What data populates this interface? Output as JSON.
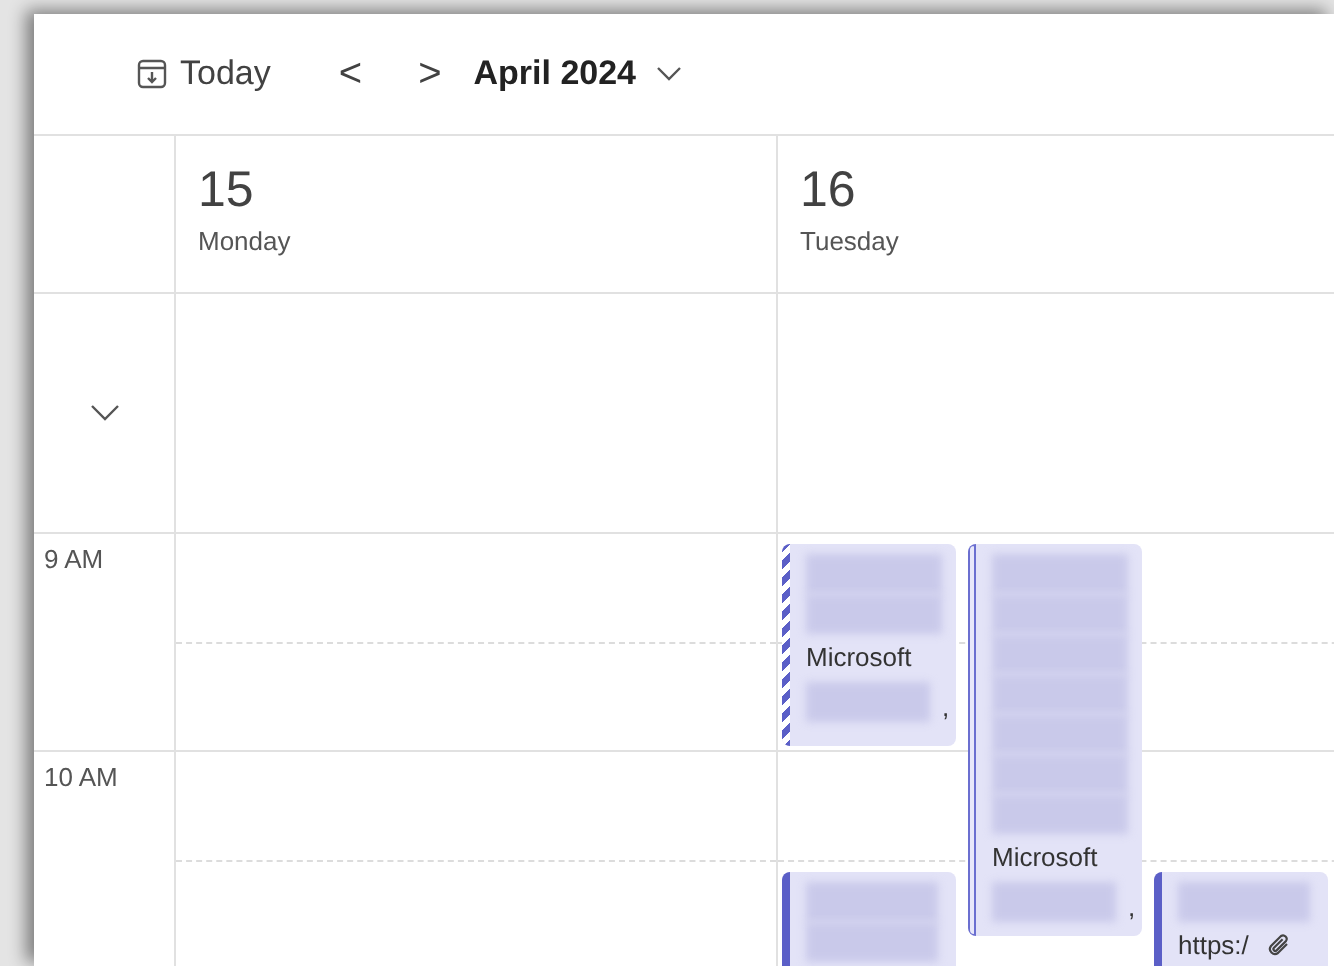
{
  "toolbar": {
    "today": "Today",
    "prev": "<",
    "next": ">",
    "month": "April 2024"
  },
  "days": [
    {
      "date": "15",
      "weekday": "Monday"
    },
    {
      "date": "16",
      "weekday": "Tuesday",
      "lanes": [
        [
          {
            "kind": "striped",
            "lines": [
              {
                "kind": "blurred"
              },
              {
                "kind": "blurred"
              },
              {
                "kind": "text",
                "text": "Microsoft"
              },
              {
                "kind": "blurred",
                "tail": ","
              }
            ]
          },
          {
            "kind": "gap"
          },
          {
            "kind": "solid",
            "lines": [
              {
                "kind": "blurred"
              },
              {
                "kind": "blurred"
              }
            ]
          }
        ],
        [
          {
            "kind": "outlined",
            "lines": [
              {
                "kind": "blurred"
              },
              {
                "kind": "blurred"
              },
              {
                "kind": "blurred"
              },
              {
                "kind": "blurred"
              },
              {
                "kind": "blurred"
              },
              {
                "kind": "blurred"
              },
              {
                "kind": "blurred"
              },
              {
                "kind": "text",
                "text": "Microsoft"
              },
              {
                "kind": "blurred",
                "tail": ","
              }
            ]
          }
        ],
        [
          {
            "kind": "gap"
          },
          {
            "kind": "gap"
          },
          {
            "kind": "gap"
          },
          {
            "kind": "solid",
            "lines": [
              {
                "kind": "blurred"
              },
              {
                "kind": "text",
                "text": "https:/",
                "attachment": true
              }
            ]
          }
        ]
      ]
    }
  ],
  "hours": [
    "9 AM",
    "10 AM"
  ]
}
